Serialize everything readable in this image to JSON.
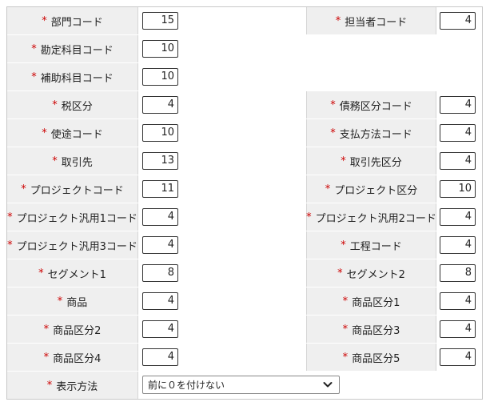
{
  "required_mark": "*",
  "rows": [
    {
      "left": {
        "label": "部門コード",
        "value": "15"
      },
      "right": {
        "label": "担当者コード",
        "value": "4"
      }
    },
    {
      "left": {
        "label": "勘定科目コード",
        "value": "10"
      }
    },
    {
      "left": {
        "label": "補助科目コード",
        "value": "10"
      }
    },
    {
      "left": {
        "label": "税区分",
        "value": "4"
      },
      "right": {
        "label": "債務区分コード",
        "value": "4"
      }
    },
    {
      "left": {
        "label": "使途コード",
        "value": "10"
      },
      "right": {
        "label": "支払方法コード",
        "value": "4"
      }
    },
    {
      "left": {
        "label": "取引先",
        "value": "13"
      },
      "right": {
        "label": "取引先区分",
        "value": "4"
      }
    },
    {
      "left": {
        "label": "プロジェクトコード",
        "value": "11"
      },
      "right": {
        "label": "プロジェクト区分",
        "value": "10"
      }
    },
    {
      "left": {
        "label": "プロジェクト汎用1コード",
        "value": "4"
      },
      "right": {
        "label": "プロジェクト汎用2コード",
        "value": "4"
      }
    },
    {
      "left": {
        "label": "プロジェクト汎用3コード",
        "value": "4"
      },
      "right": {
        "label": "工程コード",
        "value": "4"
      }
    },
    {
      "left": {
        "label": "セグメント1",
        "value": "8"
      },
      "right": {
        "label": "セグメント2",
        "value": "8"
      }
    },
    {
      "left": {
        "label": "商品",
        "value": "4"
      },
      "right": {
        "label": "商品区分1",
        "value": "4"
      }
    },
    {
      "left": {
        "label": "商品区分2",
        "value": "4"
      },
      "right": {
        "label": "商品区分3",
        "value": "4"
      }
    },
    {
      "left": {
        "label": "商品区分4",
        "value": "4"
      },
      "right": {
        "label": "商品区分5",
        "value": "4"
      }
    }
  ],
  "display_method": {
    "label": "表示方法",
    "selected": "前に０を付けない",
    "icon": "chevron-down-icon"
  },
  "colors": {
    "required": "#cc0000",
    "label_bg": "#efefef",
    "border": "#d6d6d6"
  }
}
